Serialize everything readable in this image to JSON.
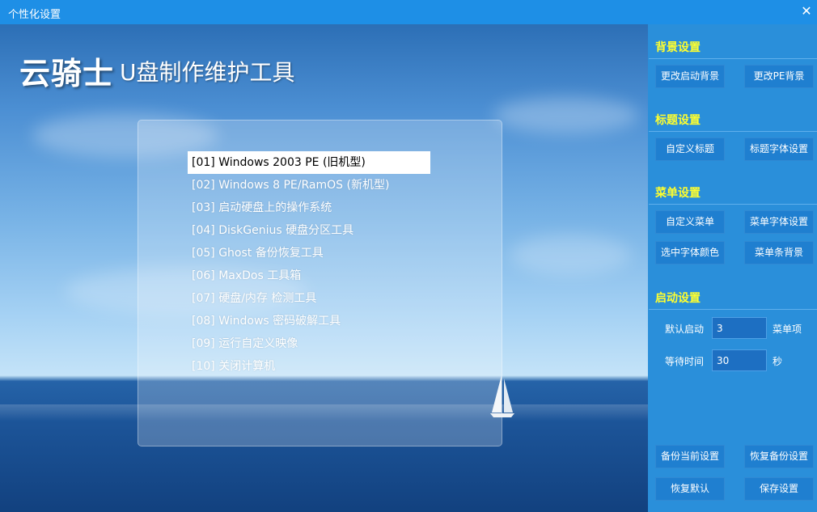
{
  "window": {
    "title": "个性化设置",
    "close_glyph": "✕"
  },
  "preview": {
    "logo_main": "云骑士",
    "logo_sub": "U盘制作维护工具",
    "menu_items": [
      "[01] Windows 2003 PE (旧机型)",
      "[02] Windows 8 PE/RamOS (新机型)",
      "[03] 启动硬盘上的操作系统",
      "[04] DiskGenius 硬盘分区工具",
      "[05] Ghost 备份恢复工具",
      "[06] MaxDos 工具箱",
      "[07] 硬盘/内存 检测工具",
      "[08] Windows 密码破解工具",
      "[09] 运行自定义映像",
      "[10] 关闭计算机"
    ],
    "selected_index": 0
  },
  "sidebar": {
    "background_section": {
      "title": "背景设置",
      "change_boot_bg": "更改启动背景",
      "change_pe_bg": "更改PE背景"
    },
    "title_section": {
      "title": "标题设置",
      "custom_title": "自定义标题",
      "title_font": "标题字体设置"
    },
    "menu_section": {
      "title": "菜单设置",
      "custom_menu": "自定义菜单",
      "menu_font": "菜单字体设置",
      "selected_font_color": "选中字体颜色",
      "menu_bar_bg": "菜单条背景"
    },
    "boot_section": {
      "title": "启动设置",
      "default_boot_label": "默认启动",
      "default_boot_value": "3",
      "default_boot_unit": "菜单项",
      "wait_time_label": "等待时间",
      "wait_time_value": "30",
      "wait_time_unit": "秒"
    },
    "actions": {
      "backup_current": "备份当前设置",
      "restore_backup": "恢复备份设置",
      "restore_default": "恢复默认",
      "save": "保存设置"
    }
  },
  "colors": {
    "titlebar": "#1e8fe6",
    "sidebar": "#2a8fda",
    "section_title": "#ffff2e",
    "button": "#1f7fd0"
  }
}
